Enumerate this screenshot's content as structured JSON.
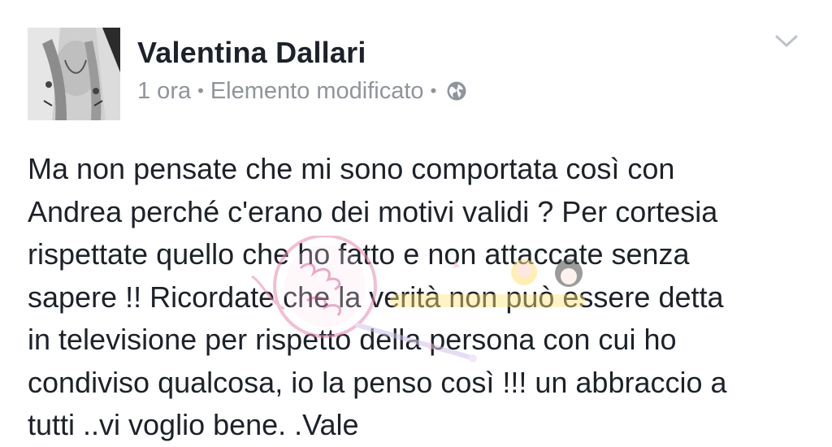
{
  "post": {
    "author": "Valentina Dallari",
    "timestamp": "1 ora",
    "edited_label": "Elemento modificato",
    "separator": "•",
    "privacy_icon": "globe-icon",
    "menu_icon": "chevron-down-icon",
    "text": "Ma non pensate che mi sono comportata così con\nAndrea perché c'erano dei motivi validi ? Per cortesia\nrispettate quello che ho fatto e non attaccate senza\nsapere !! Ricordate che la verità non può essere detta\nin televisione per rispetto della persona con cui ho\ncondiviso qualcosa, io la penso così  !!! un abbraccio a\ntutti ..vi voglio bene. .Vale"
  },
  "colors": {
    "text_primary": "#1d2129",
    "text_secondary": "#90949c",
    "watermark_pink": "#e98ab0"
  }
}
